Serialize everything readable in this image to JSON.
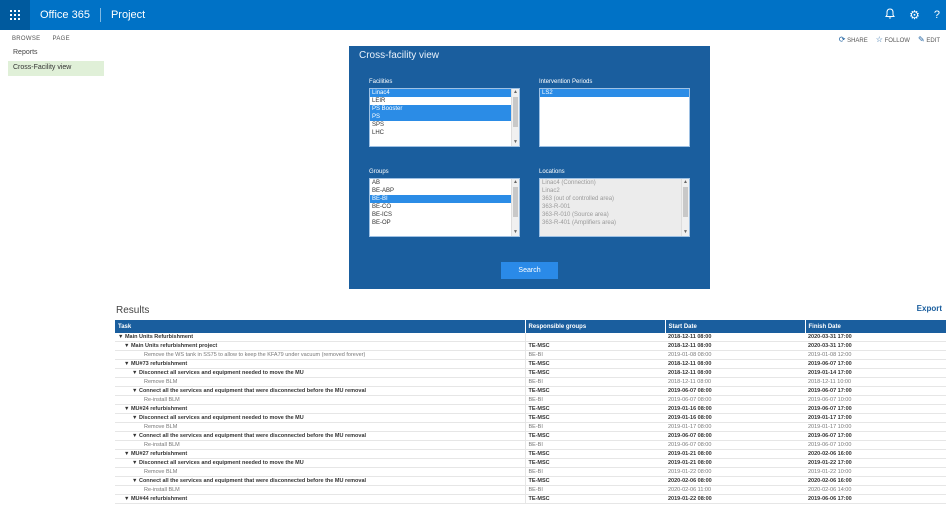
{
  "suitebar": {
    "waffle_icon": "app-launcher-icon",
    "brand": "Office 365",
    "app": "Project",
    "icons": [
      "bell-icon",
      "gear-icon",
      "help-icon"
    ]
  },
  "ribbon": {
    "tabs": [
      "BROWSE",
      "PAGE"
    ],
    "actions": [
      {
        "icon": "share-icon",
        "label": "SHARE",
        "glyph": "⟳"
      },
      {
        "icon": "star-icon",
        "label": "FOLLOW",
        "glyph": "☆"
      },
      {
        "icon": "pencil-icon",
        "label": "EDIT",
        "glyph": "✎"
      }
    ]
  },
  "leftnav": {
    "items": [
      {
        "label": "Reports",
        "active": false
      },
      {
        "label": "Cross-Facility view",
        "active": true
      }
    ]
  },
  "panel": {
    "title": "Cross-facility view",
    "facilities": {
      "label": "Facilities",
      "options": [
        {
          "text": "Linac4",
          "selected": true
        },
        {
          "text": "LEIR",
          "selected": false
        },
        {
          "text": "PS Booster",
          "selected": true
        },
        {
          "text": "PS",
          "selected": true
        },
        {
          "text": "SPS",
          "selected": false
        },
        {
          "text": "LHC",
          "selected": false
        }
      ]
    },
    "intervention_periods": {
      "label": "Intervention Periods",
      "options": [
        {
          "text": "LS2",
          "selected": true
        }
      ]
    },
    "groups": {
      "label": "Groups",
      "options": [
        {
          "text": "AB",
          "selected": false
        },
        {
          "text": "BE-ABP",
          "selected": false
        },
        {
          "text": "BE-BI",
          "selected": true
        },
        {
          "text": "BE-CO",
          "selected": false
        },
        {
          "text": "BE-ICS",
          "selected": false
        },
        {
          "text": "BE-OP",
          "selected": false
        }
      ]
    },
    "locations": {
      "label": "Locations",
      "options": [
        {
          "text": "Linac4 (Connection)"
        },
        {
          "text": "Linac2"
        },
        {
          "text": "363 (out of controlled area)"
        },
        {
          "text": "363-R-001"
        },
        {
          "text": "363-R-010 (Source area)"
        },
        {
          "text": "363-R-401 (Amplifiers area)"
        }
      ]
    },
    "search_label": "Search"
  },
  "results": {
    "title": "Results",
    "export_label": "Export",
    "columns": [
      "Task",
      "Responsible groups",
      "Start Date",
      "Finish Date"
    ],
    "rows": [
      {
        "task": "▼ Main Units Refurbishment",
        "indent": 0,
        "bold": true,
        "group": "",
        "start": "2018-12-11 08:00",
        "finish": "2020-03-31 17:00"
      },
      {
        "task": "▼ Main Units refurbishment project",
        "indent": 1,
        "bold": true,
        "group": "TE-MSC",
        "start": "2018-12-11 08:00",
        "finish": "2020-03-31 17:00"
      },
      {
        "task": "Remove the WS tank in SS75 to allow to keep the KFA79 under vacuum (removed forever)",
        "indent": 3,
        "bold": false,
        "group": "BE-BI",
        "start": "2019-01-08 08:00",
        "finish": "2019-01-08 12:00"
      },
      {
        "task": "▼ MU#73 refurbishment",
        "indent": 1,
        "bold": true,
        "group": "TE-MSC",
        "start": "2018-12-11 08:00",
        "finish": "2019-06-07 17:00"
      },
      {
        "task": "▼ Disconnect all services and equipment needed to move the MU",
        "indent": 2,
        "bold": true,
        "group": "TE-MSC",
        "start": "2018-12-11 08:00",
        "finish": "2019-01-14 17:00"
      },
      {
        "task": "Remove BLM",
        "indent": 3,
        "bold": false,
        "group": "BE-BI",
        "start": "2018-12-11 08:00",
        "finish": "2018-12-11 10:00"
      },
      {
        "task": "▼ Connect all the services and equipment that were disconnected before the MU removal",
        "indent": 2,
        "bold": true,
        "group": "TE-MSC",
        "start": "2019-06-07 08:00",
        "finish": "2019-06-07 17:00"
      },
      {
        "task": "Re-install BLM",
        "indent": 3,
        "bold": false,
        "group": "BE-BI",
        "start": "2019-06-07 08:00",
        "finish": "2019-06-07 10:00"
      },
      {
        "task": "▼ MU#24 refurbishment",
        "indent": 1,
        "bold": true,
        "group": "TE-MSC",
        "start": "2019-01-16 08:00",
        "finish": "2019-06-07 17:00"
      },
      {
        "task": "▼ Disconnect all services and equipment needed to move the MU",
        "indent": 2,
        "bold": true,
        "group": "TE-MSC",
        "start": "2019-01-16 08:00",
        "finish": "2019-01-17 17:00"
      },
      {
        "task": "Remove BLM",
        "indent": 3,
        "bold": false,
        "group": "BE-BI",
        "start": "2019-01-17 08:00",
        "finish": "2019-01-17 10:00"
      },
      {
        "task": "▼ Connect all the services and equipment that were disconnected before the MU removal",
        "indent": 2,
        "bold": true,
        "group": "TE-MSC",
        "start": "2019-06-07 08:00",
        "finish": "2019-06-07 17:00"
      },
      {
        "task": "Re-install BLM",
        "indent": 3,
        "bold": false,
        "group": "BE-BI",
        "start": "2019-06-07 08:00",
        "finish": "2019-06-07 10:00"
      },
      {
        "task": "▼ MU#27 refurbishment",
        "indent": 1,
        "bold": true,
        "group": "TE-MSC",
        "start": "2019-01-21 08:00",
        "finish": "2020-02-06 16:00"
      },
      {
        "task": "▼ Disconnect all services and equipment needed to move the MU",
        "indent": 2,
        "bold": true,
        "group": "TE-MSC",
        "start": "2019-01-21 08:00",
        "finish": "2019-01-22 17:00"
      },
      {
        "task": "Remove BLM",
        "indent": 3,
        "bold": false,
        "group": "BE-BI",
        "start": "2019-01-22 08:00",
        "finish": "2019-01-22 10:00"
      },
      {
        "task": "▼ Connect all the services and equipment that were disconnected before the MU removal",
        "indent": 2,
        "bold": true,
        "group": "TE-MSC",
        "start": "2020-02-06 08:00",
        "finish": "2020-02-06 16:00"
      },
      {
        "task": "Re-install BLM",
        "indent": 3,
        "bold": false,
        "group": "BE-BI",
        "start": "2020-02-06 11:00",
        "finish": "2020-02-06 14:00"
      },
      {
        "task": "▼ MU#44 refurbishment",
        "indent": 1,
        "bold": true,
        "group": "TE-MSC",
        "start": "2019-01-22 08:00",
        "finish": "2019-06-06 17:00"
      }
    ]
  }
}
